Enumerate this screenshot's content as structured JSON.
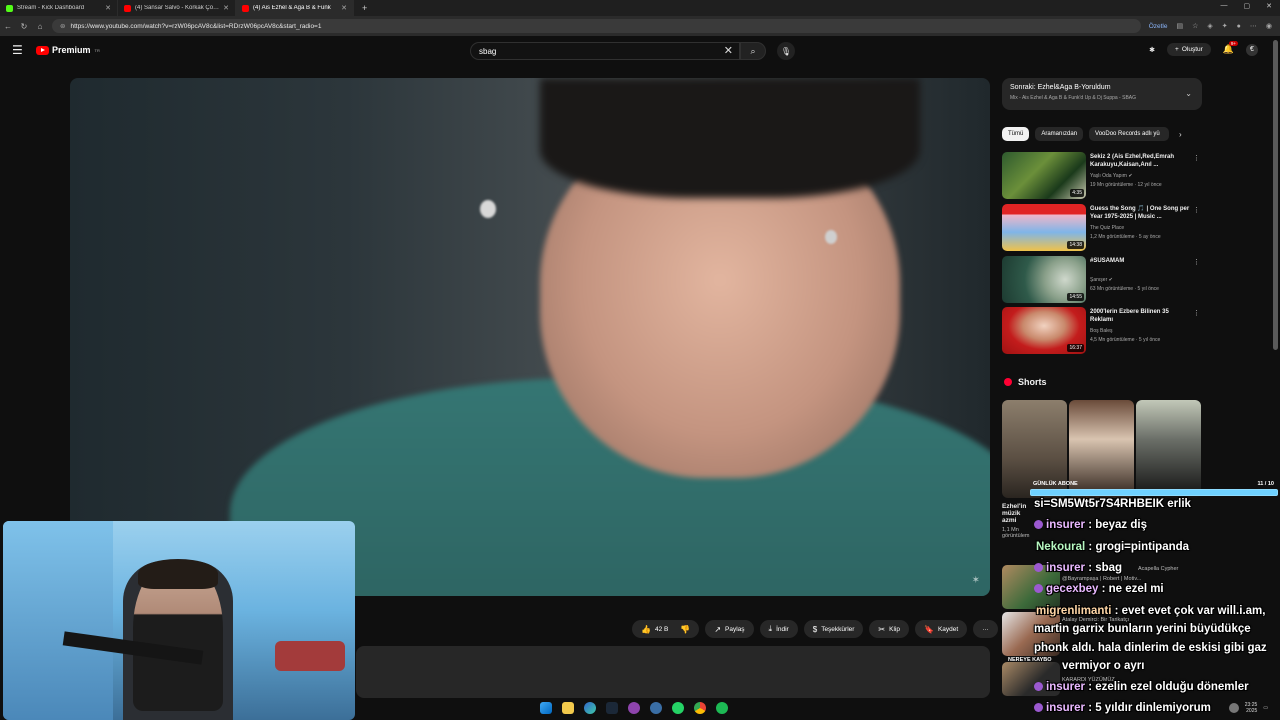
{
  "browser": {
    "tabs": [
      {
        "label": "Stream - Kick Dashboard",
        "color": "#53fc18"
      },
      {
        "label": "(4) Sansar Salvo - Korkak Çocuk (Off",
        "color": "#ff0000"
      },
      {
        "label": "(4) Ais Ezhel & Aga B & Funk",
        "color": "#ff0000"
      }
    ],
    "new_tab": "+",
    "url": "https://www.youtube.com/watch?v=rzW06pcAV8c&list=RDrzW06pcAV8c&start_radio=1",
    "ozetle": "Özetle",
    "window_controls": [
      "—",
      "▢",
      "✕"
    ]
  },
  "youtube": {
    "logo_text": "Premium",
    "logo_sup": "TR",
    "search_value": "sbag",
    "create_label": "Oluştur",
    "notif_count": "9+",
    "avatar_letter": "€"
  },
  "actions": {
    "like_count": "42 B",
    "share": "Paylaş",
    "download": "İndir",
    "thanks": "Teşekkürler",
    "clip": "Klip",
    "save": "Kaydet",
    "more": "···"
  },
  "sidebar": {
    "upnext_title": "Sonraki: Ezhel&Aga B-Yoruldum",
    "upnext_sub": "Mix - Ais Ezhel & Aga B & Funk'd Up & Dj Suppa - SBAG",
    "chips": [
      "Tümü",
      "Aramanızdan",
      "VooDoo Records adlı yü"
    ],
    "recs": [
      {
        "title": "Sekiz 2 (Ais Ezhel,Red,Emrah Karakuyu,Kaisan,Anıl ...",
        "channel": "Yaşlı Oda Yapım ✔",
        "meta": "19 Mn görüntüleme · 12 yıl önce",
        "duration": "4:35"
      },
      {
        "title": "Guess the Song 🎵 | One Song per Year 1975-2025 | Music ...",
        "channel": "The Quiz Place",
        "meta": "1,2 Mn görüntüleme · 5 ay önce",
        "duration": "14:38"
      },
      {
        "title": "#SUSAMAM",
        "channel": "Şanışer ✔",
        "meta": "63 Mn görüntüleme · 5 yıl önce",
        "duration": "14:55"
      },
      {
        "title": "2000'lerin Ezbere Bilinen 35 Reklamı",
        "channel": "Boş Baleş",
        "meta": "4,5 Mn görüntüleme · 5 yıl önce",
        "duration": "16:37"
      }
    ],
    "shorts_title": "Shorts"
  },
  "overlay": {
    "progress_label": "GÜNLÜK ABONE",
    "progress_count": "11 / 10",
    "progress_fraction": 1.0
  },
  "chat": [
    {
      "user": "",
      "text": "si=SM5Wt5r7S4RHBEIK erlik"
    },
    {
      "user": "insurer",
      "text": " : beyaz diş"
    },
    {
      "user": "Nekoural",
      "text": " : grogi=pintipanda"
    },
    {
      "user": "insurer",
      "text": " : sbag"
    },
    {
      "user": "gecexbey",
      "text": " : ne ezel mi"
    },
    {
      "user": "migrenlimanti",
      "text": " : evet evet çok var will.i.am,"
    },
    {
      "user": "",
      "text": "martin garrix bunların yerini büyüdükçe"
    },
    {
      "user": "",
      "text": "phonk aldı. hala dinlerim de eskisi gibi gaz"
    },
    {
      "user": "",
      "text": "vermiyor o ayrı"
    },
    {
      "user": "insurer",
      "text": " : ezelin ezel olduğu dönemler"
    },
    {
      "user": "insurer",
      "text": " : 5 yıldır dinlemiyorum"
    }
  ],
  "ghost": {
    "short_title": "Ezhel'in müzik azmi",
    "short_views": "1,1 Mn görüntülem",
    "rec5_title": "Acapella Cypher",
    "rec5_chan": "@Bayrampaşa | Robert | Motiv...",
    "rec6_chan": "Atalay Demirci: Bir Tarikatçı",
    "rec7_title": "KARARDI YÜZÜMÜZ",
    "rec7_chan": "NEREYE KAYBO"
  },
  "tray": {
    "time": "23:25",
    "date": "2025"
  }
}
